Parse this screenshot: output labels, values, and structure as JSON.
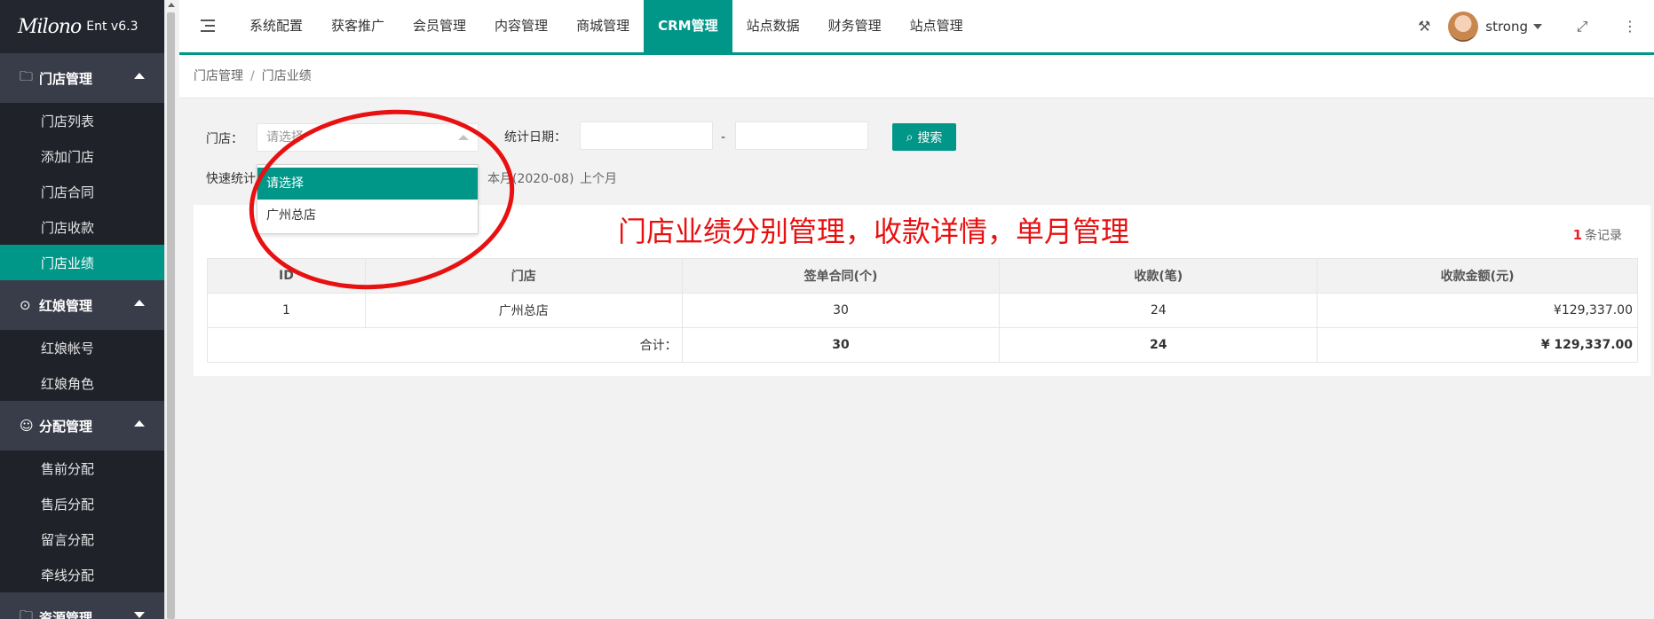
{
  "sidebar": {
    "logo_text": "Milono",
    "version": "Ent v6.3",
    "groups": [
      {
        "icon": "folder-icon",
        "label": "门店管理",
        "expanded": true,
        "items": [
          "门店列表",
          "添加门店",
          "门店合同",
          "门店收款",
          "门店业绩"
        ],
        "active": "门店业绩"
      },
      {
        "icon": "headset-icon",
        "label": "红娘管理",
        "expanded": true,
        "items": [
          "红娘帐号",
          "红娘角色"
        ]
      },
      {
        "icon": "user-assign-icon",
        "label": "分配管理",
        "expanded": true,
        "items": [
          "售前分配",
          "售后分配",
          "留言分配",
          "牵线分配"
        ]
      },
      {
        "icon": "folder-icon",
        "label": "资源管理",
        "expanded": false,
        "items": []
      }
    ]
  },
  "header": {
    "nav": [
      "系统配置",
      "获客推广",
      "会员管理",
      "内容管理",
      "商城管理",
      "CRM管理",
      "站点数据",
      "财务管理",
      "站点管理"
    ],
    "active_nav": "CRM管理",
    "username": "strong"
  },
  "breadcrumb": {
    "parent": "门店管理",
    "current": "门店业绩",
    "separator": "/"
  },
  "filters": {
    "store_label": "门店：",
    "store_placeholder": "请选择",
    "date_label": "统计日期：",
    "date_separator": "-",
    "search_label": "搜索",
    "quick_label": "快速统计",
    "quick_this_month": "本月(2020-08)",
    "quick_last_month": "上个月"
  },
  "dropdown": {
    "options": [
      "请选择",
      "广州总店"
    ],
    "selected": "请选择"
  },
  "results": {
    "count": "1",
    "count_suffix": "条记录"
  },
  "table": {
    "headers": [
      "ID",
      "门店",
      "签单合同(个)",
      "收款(笔)",
      "收款金额(元)"
    ],
    "rows": [
      [
        "1",
        "广州总店",
        "30",
        "24",
        "¥129,337.00"
      ]
    ],
    "total": {
      "label": "合计：",
      "contracts": "30",
      "payments": "24",
      "amount": "¥ 129,337.00"
    }
  },
  "annotation": "门店业绩分别管理，收款详情，单月管理",
  "colors": {
    "accent": "#009688",
    "sidebar_bg": "#20222a",
    "annotation": "#e81010"
  }
}
